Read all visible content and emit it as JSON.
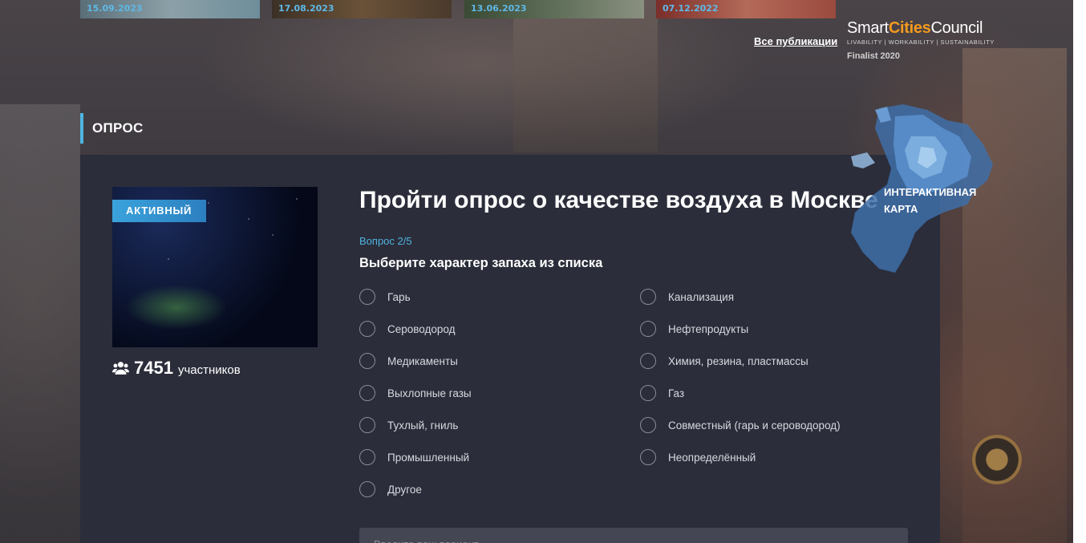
{
  "header": {
    "publications": [
      {
        "date": "15.09.2023"
      },
      {
        "date": "17.08.2023"
      },
      {
        "date": "13.06.2023"
      },
      {
        "date": "07.12.2022"
      }
    ],
    "all_publications_link": "Все публикации",
    "scc": {
      "logo_part1": "Smart",
      "logo_part2": "Cities",
      "logo_part3": "Council",
      "tagline": "LIVABILITY | WORKABILITY | SUSTAINABILITY",
      "finalist": "Finalist 2020"
    }
  },
  "section": {
    "title": "ОПРОС"
  },
  "poll": {
    "status_badge": "АКТИВНЫЙ",
    "participants_count": "7451",
    "participants_label": "участников",
    "title": "Пройти опрос о качестве воздуха в Москве",
    "question_number": "Вопрос 2/5",
    "question_text": "Выберите характер запаха из списка",
    "options_left": [
      "Гарь",
      "Сероводород",
      "Медикаменты",
      "Выхлопные газы",
      "Тухлый, гниль",
      "Промышленный",
      "Другое"
    ],
    "options_right": [
      "Канализация",
      "Нефтепродукты",
      "Химия, резина, пластмассы",
      "Газ",
      "Совместный (гарь и сероводород)",
      "Неопределённый"
    ],
    "custom_input_placeholder": "Введите ваш вариант"
  },
  "map": {
    "label_line1": "ИНТЕРАКТИВНАЯ",
    "label_line2": "КАРТА"
  },
  "colors": {
    "accent": "#4fb3e0",
    "panel": "#2b2d3a",
    "badge": "#3aa3dc",
    "scc_orange": "#f39a1e"
  },
  "icons": {
    "participants": "users-icon",
    "map": "moscow-map-icon"
  }
}
